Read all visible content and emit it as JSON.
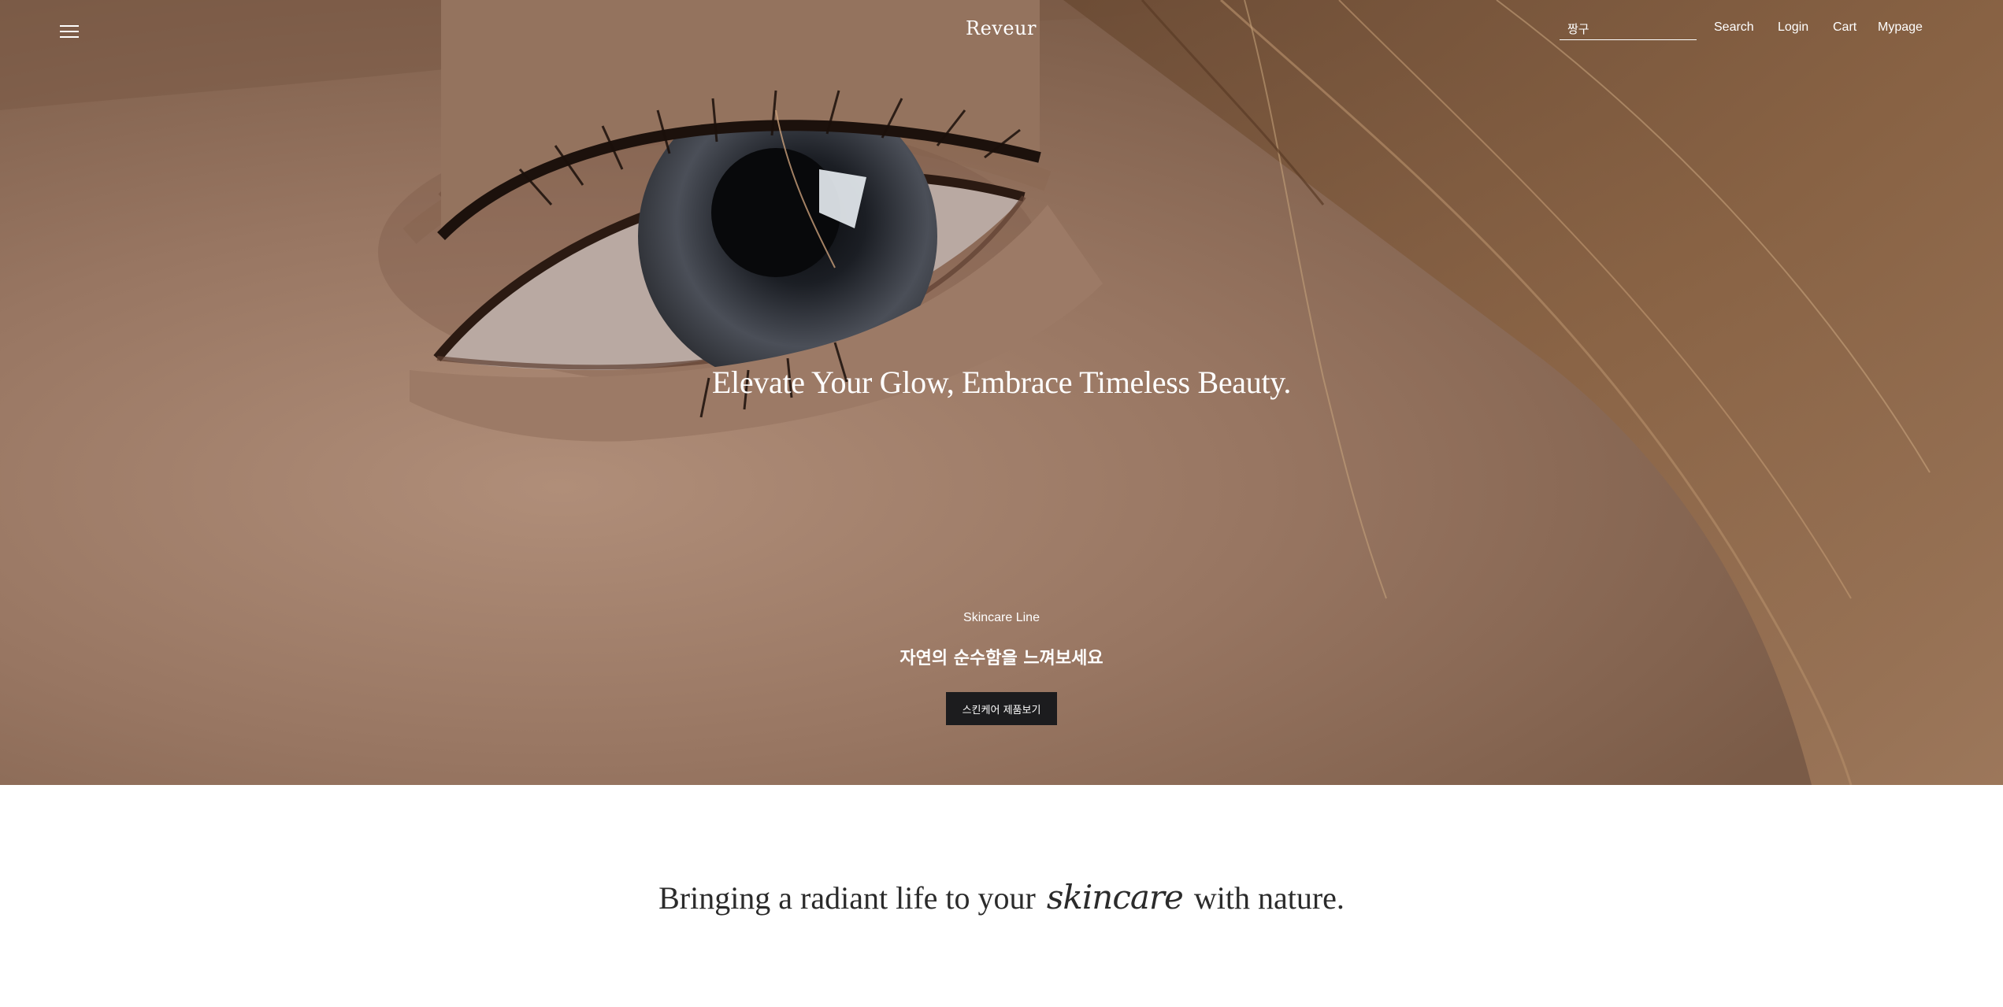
{
  "header": {
    "logo": "Reveur",
    "search": {
      "value": "짱구",
      "placeholder": ""
    },
    "nav_links": [
      {
        "label": "Search"
      },
      {
        "label": "Login"
      },
      {
        "label": "Cart"
      },
      {
        "label": "Mypage"
      }
    ]
  },
  "hero": {
    "title": "Elevate Your Glow, Embrace Timeless Beauty.",
    "eyebrow": "Skincare Line",
    "subtitle": "자연의 순수함을 느껴보세요",
    "cta_label": "스킨케어 제품보기"
  },
  "tagline": {
    "before": "Bringing a radiant life to your",
    "emphasis": "skincare",
    "after": "with nature."
  },
  "icons": {
    "menu": "hamburger-menu-icon"
  },
  "colors": {
    "cta_background": "#1c1c1e",
    "hero_overlay_text": "#ffffff",
    "body_text": "#2b2b2b"
  }
}
